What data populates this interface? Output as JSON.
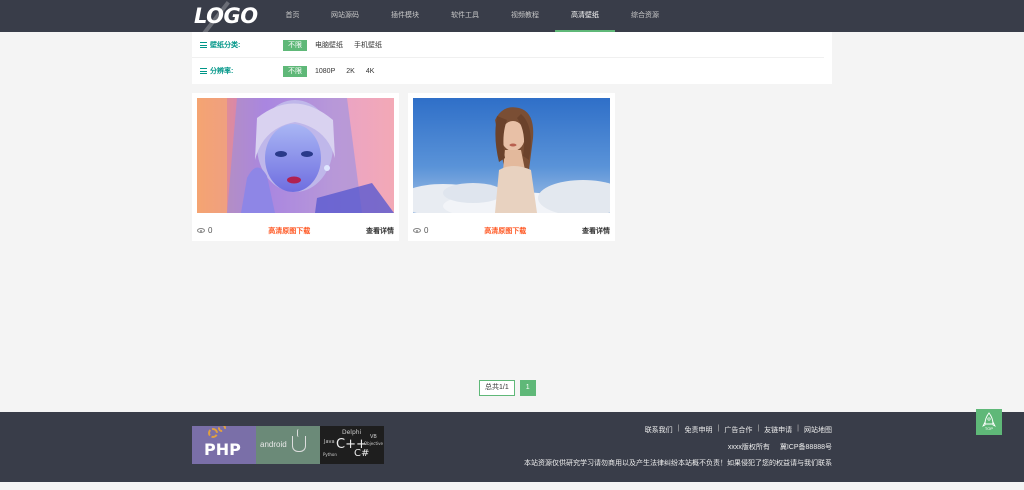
{
  "header": {
    "logo": "LOGO",
    "nav": [
      "首页",
      "网站源码",
      "插件模块",
      "软件工具",
      "视频教程",
      "高清壁纸",
      "综合资源"
    ],
    "active_index": 5
  },
  "filters": {
    "category": {
      "label": "壁纸分类:",
      "options": [
        "不限",
        "电脑壁纸",
        "手机壁纸"
      ],
      "selected": "不限"
    },
    "resolution": {
      "label": "分辨率:",
      "options": [
        "不限",
        "1080P",
        "2K",
        "4K"
      ],
      "selected": "不限"
    }
  },
  "cards": [
    {
      "views": "0",
      "download_label": "高清原图下载",
      "detail_label": "查看详情"
    },
    {
      "views": "0",
      "download_label": "高清原图下载",
      "detail_label": "查看详情"
    }
  ],
  "pagination": {
    "total_label": "总共1/1",
    "current": "1"
  },
  "footer": {
    "links": [
      "联系我们",
      "免责申明",
      "广告合作",
      "友链申请",
      "网站地图"
    ],
    "separator": "|",
    "copyright": "xxxx版权所有",
    "icp": "冀ICP备88888号",
    "note": "本站资源仅供研究学习请勿商用以及产生法律纠纷本站概不负责！如果侵犯了您的权益请与我们联系",
    "logo_texts": {
      "php": "PHP",
      "android": "android",
      "code_words": [
        "Delphi",
        "Java",
        "C++",
        "C#",
        "Python",
        "VB",
        "Objective"
      ]
    }
  },
  "back_to_top_label": "TOP",
  "colors": {
    "header_bg": "#393d49",
    "accent_green": "#5fb878",
    "label_teal": "#009688",
    "download_orange": "#ff5722"
  }
}
